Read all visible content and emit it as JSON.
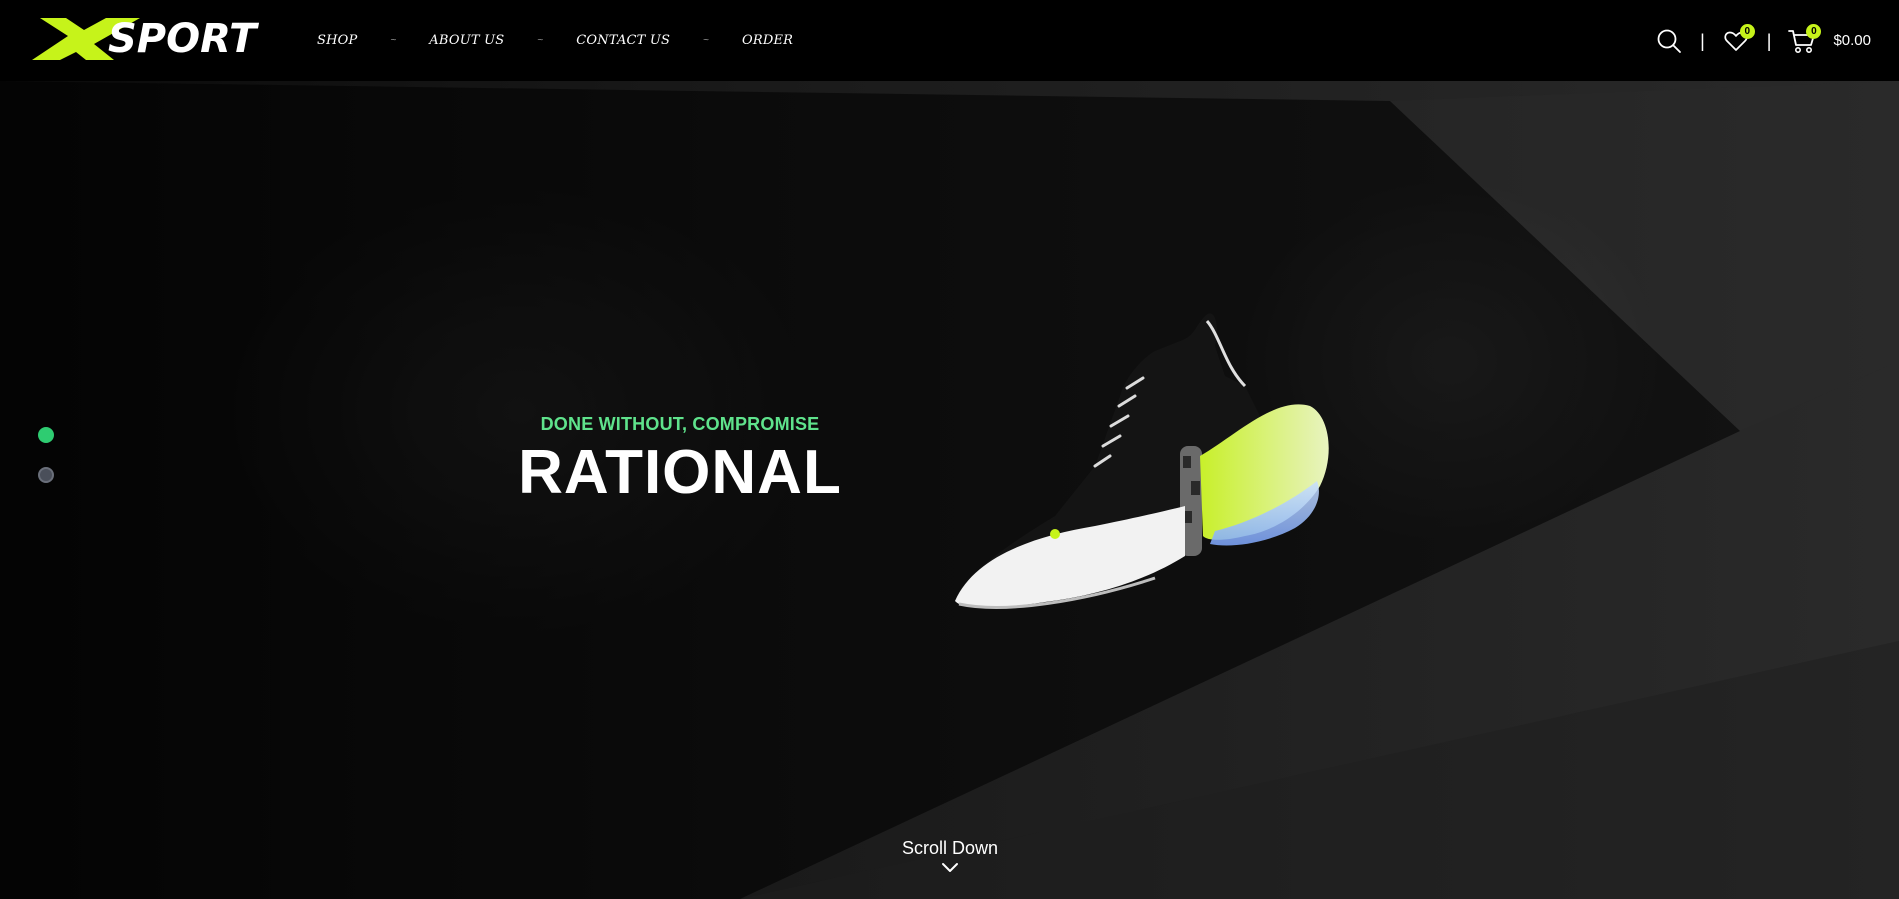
{
  "brand": {
    "logo_mark": "X",
    "logo_text": "SPORT",
    "accent_color": "#c6f31a"
  },
  "nav": {
    "items": [
      {
        "label": "SHOP"
      },
      {
        "label": "ABOUT US"
      },
      {
        "label": "CONTACT US"
      },
      {
        "label": "ORDER"
      }
    ],
    "separator": "~"
  },
  "header": {
    "divider": "|",
    "wishlist_count": "0",
    "cart_count": "0",
    "cart_total": "$0.00",
    "icons": [
      "search-icon",
      "heart-icon",
      "cart-icon"
    ]
  },
  "hero": {
    "subtitle": "DONE WITHOUT, COMPROMISE",
    "title": "RATIONAL",
    "subtitle_color": "#5fe38c",
    "slides": {
      "count": 2,
      "active": 1
    },
    "scroll_label": "Scroll Down"
  }
}
